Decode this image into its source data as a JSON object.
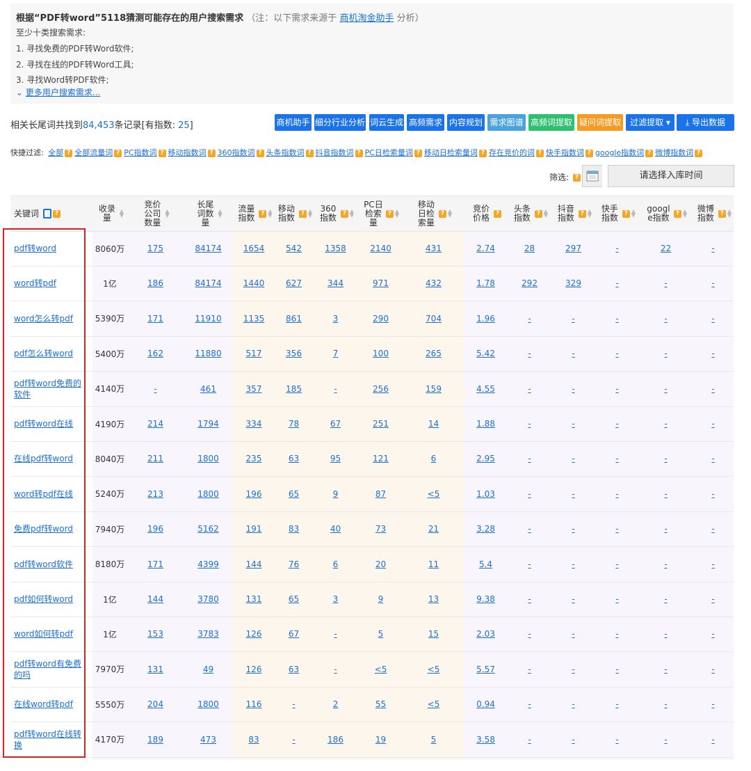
{
  "intro": {
    "title_pre": "根据“PDF转word”5118猜测可能存在的用户搜索需求",
    "note_pre": "（注：以下需求来源于",
    "note_link": "商机淘金助手",
    "note_post": "分析）",
    "line0": "至少十类搜索需求:",
    "line1": "1. 寻找免费的PDF转Word软件;",
    "line2": "2. 寻找在线的PDF转Word工具;",
    "line3": "3. 寻找Word转PDF软件;",
    "more": "更多用户搜索需求..."
  },
  "summary": {
    "pre": "相关长尾词共找到",
    "count": "84,453",
    "mid": "条记录[有指数:",
    "indexed": "25",
    "post": "]"
  },
  "buttons": [
    {
      "label": "商机助手",
      "color": "#1a73e8"
    },
    {
      "label": "细分行业分析",
      "color": "#1a73e8"
    },
    {
      "label": "词云生成",
      "color": "#1a73e8"
    },
    {
      "label": "高频需求",
      "color": "#1a73e8"
    },
    {
      "label": "内容规划",
      "color": "#1a73e8"
    },
    {
      "label": "需求图谱",
      "color": "#4aa3df"
    },
    {
      "label": "高频词提取",
      "color": "#2fbf71"
    },
    {
      "label": "疑问词提取",
      "color": "#f59a23"
    },
    {
      "label": "过滤提取 ▾",
      "color": "#1a73e8"
    },
    {
      "label": "导出数据",
      "color": "#1a73e8"
    }
  ],
  "quick_filter": {
    "label": "快捷过滤:",
    "items": [
      "全部",
      "全部流量词",
      "PC指数词",
      "移动指数词",
      "360指数词",
      "头条指数词",
      "抖音指数词",
      "PC日检索量词",
      "移动日检索量词",
      "存在竞价的词",
      "快手指数词",
      "google指数词",
      "微博指数词"
    ]
  },
  "filter": {
    "label": "筛选:",
    "placeholder": "请选择入库时间"
  },
  "columns": [
    "关键词",
    "收录量",
    "竞价公司数量",
    "长尾词数量",
    "流量指数",
    "移动指数",
    "360指数",
    "PC日检索量",
    "移动日检索量",
    "竞价价格",
    "头条指数",
    "抖音指数",
    "快手指数",
    "google指数",
    "微博指数"
  ],
  "rows": [
    [
      "pdf转word",
      "8060万",
      "175",
      "84174",
      "1654",
      "542",
      "1358",
      "2140",
      "431",
      "2.74",
      "28",
      "297",
      "-",
      "22",
      "-"
    ],
    [
      "word转pdf",
      "1亿",
      "186",
      "84174",
      "1440",
      "627",
      "344",
      "971",
      "432",
      "1.78",
      "292",
      "329",
      "-",
      "-",
      "-"
    ],
    [
      "word怎么转pdf",
      "5390万",
      "171",
      "11910",
      "1135",
      "861",
      "3",
      "290",
      "704",
      "1.96",
      "-",
      "-",
      "-",
      "-",
      "-"
    ],
    [
      "pdf怎么转word",
      "5400万",
      "162",
      "11880",
      "517",
      "356",
      "7",
      "100",
      "265",
      "5.42",
      "-",
      "-",
      "-",
      "-",
      "-"
    ],
    [
      "pdf转word免费的软件",
      "4140万",
      "-",
      "461",
      "357",
      "185",
      "-",
      "256",
      "159",
      "4.55",
      "-",
      "-",
      "-",
      "-",
      "-"
    ],
    [
      "pdf转word在线",
      "4190万",
      "214",
      "1794",
      "334",
      "78",
      "67",
      "251",
      "14",
      "1.88",
      "-",
      "-",
      "-",
      "-",
      "-"
    ],
    [
      "在线pdf转word",
      "8040万",
      "211",
      "1800",
      "235",
      "63",
      "95",
      "121",
      "6",
      "2.95",
      "-",
      "-",
      "-",
      "-",
      "-"
    ],
    [
      "word转pdf在线",
      "5240万",
      "213",
      "1800",
      "196",
      "65",
      "9",
      "87",
      "<5",
      "1.03",
      "-",
      "-",
      "-",
      "-",
      "-"
    ],
    [
      "免费pdf转word",
      "7940万",
      "196",
      "5162",
      "191",
      "83",
      "40",
      "73",
      "21",
      "3.28",
      "-",
      "-",
      "-",
      "-",
      "-"
    ],
    [
      "pdf转word软件",
      "8180万",
      "171",
      "4399",
      "144",
      "76",
      "6",
      "20",
      "11",
      "5.4",
      "-",
      "-",
      "-",
      "-",
      "-"
    ],
    [
      "pdf如何转word",
      "1亿",
      "144",
      "3780",
      "131",
      "65",
      "3",
      "9",
      "13",
      "9.38",
      "-",
      "-",
      "-",
      "-",
      "-"
    ],
    [
      "word如何转pdf",
      "1亿",
      "153",
      "3783",
      "126",
      "67",
      "-",
      "5",
      "15",
      "2.03",
      "-",
      "-",
      "-",
      "-",
      "-"
    ],
    [
      "pdf转word有免费的吗",
      "7970万",
      "131",
      "49",
      "126",
      "63",
      "-",
      "<5",
      "<5",
      "5.57",
      "-",
      "-",
      "-",
      "-",
      "-"
    ],
    [
      "在线word转pdf",
      "5550万",
      "204",
      "1800",
      "116",
      "-",
      "2",
      "55",
      "<5",
      "0.94",
      "-",
      "-",
      "-",
      "-",
      "-"
    ],
    [
      "pdf转word在线转换",
      "4170万",
      "189",
      "473",
      "83",
      "-",
      "186",
      "19",
      "5",
      "3.58",
      "-",
      "-",
      "-",
      "-",
      "-"
    ]
  ]
}
